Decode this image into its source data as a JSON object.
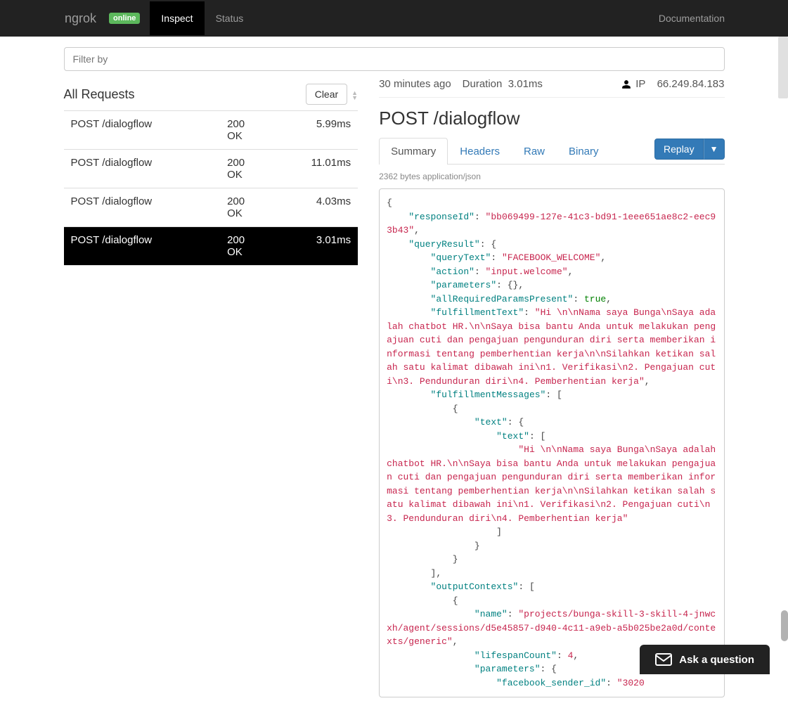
{
  "nav": {
    "brand": "ngrok",
    "status_badge": "online",
    "inspect": "Inspect",
    "status": "Status",
    "documentation": "Documentation"
  },
  "filter": {
    "placeholder": "Filter by"
  },
  "list": {
    "heading": "All Requests",
    "clear": "Clear",
    "rows": [
      {
        "method_path": "POST /dialogflow",
        "code": "200",
        "status": "OK",
        "time": "5.99ms",
        "selected": false
      },
      {
        "method_path": "POST /dialogflow",
        "code": "200",
        "status": "OK",
        "time": "11.01ms",
        "selected": false
      },
      {
        "method_path": "POST /dialogflow",
        "code": "200",
        "status": "OK",
        "time": "4.03ms",
        "selected": false
      },
      {
        "method_path": "POST /dialogflow",
        "code": "200",
        "status": "OK",
        "time": "3.01ms",
        "selected": true
      }
    ]
  },
  "detail": {
    "ago": "30 minutes ago",
    "duration_label": "Duration",
    "duration_value": "3.01ms",
    "ip_label": "IP",
    "ip_value": "66.249.84.183",
    "title": "POST /dialogflow",
    "tabs": {
      "summary": "Summary",
      "headers": "Headers",
      "raw": "Raw",
      "binary": "Binary"
    },
    "replay": "Replay",
    "bytes": "2362 bytes application/json",
    "json": {
      "responseId": "bb069499-127e-41c3-bd91-1eee651ae8c2-eec93b43",
      "queryText": "FACEBOOK_WELCOME",
      "action": "input.welcome",
      "allReq": "true",
      "fulfillmentText": "Hi \\n\\nNama saya Bunga\\nSaya adalah chatbot HR.\\n\\nSaya bisa bantu Anda untuk melakukan pengajuan cuti dan pengajuan pengunduran diri serta memberikan informasi tentang pemberhentian kerja\\n\\nSilahkan ketikan salah satu kalimat dibawah ini\\n1. Verifikasi\\n2. Pengajuan cuti\\n3. Pendunduran diri\\n4. Pemberhentian kerja",
      "fulfillmentMsgText": "Hi \\n\\nNama saya Bunga\\nSaya adalah chatbot HR.\\n\\nSaya bisa bantu Anda untuk melakukan pengajuan cuti dan pengajuan pengunduran diri serta memberikan informasi tentang pemberhentian kerja\\n\\nSilahkan ketikan salah satu kalimat dibawah ini\\n1. Verifikasi\\n2. Pengajuan cuti\\n3. Pendunduran diri\\n4. Pemberhentian kerja",
      "contextName": "projects/bunga-skill-3-skill-4-jnwcxh/agent/sessions/d5e45857-d940-4c11-a9eb-a5b025be2a0d/contexts/generic",
      "lifespan": "4",
      "fbSender": "\"3020"
    }
  },
  "ask": "Ask a question"
}
